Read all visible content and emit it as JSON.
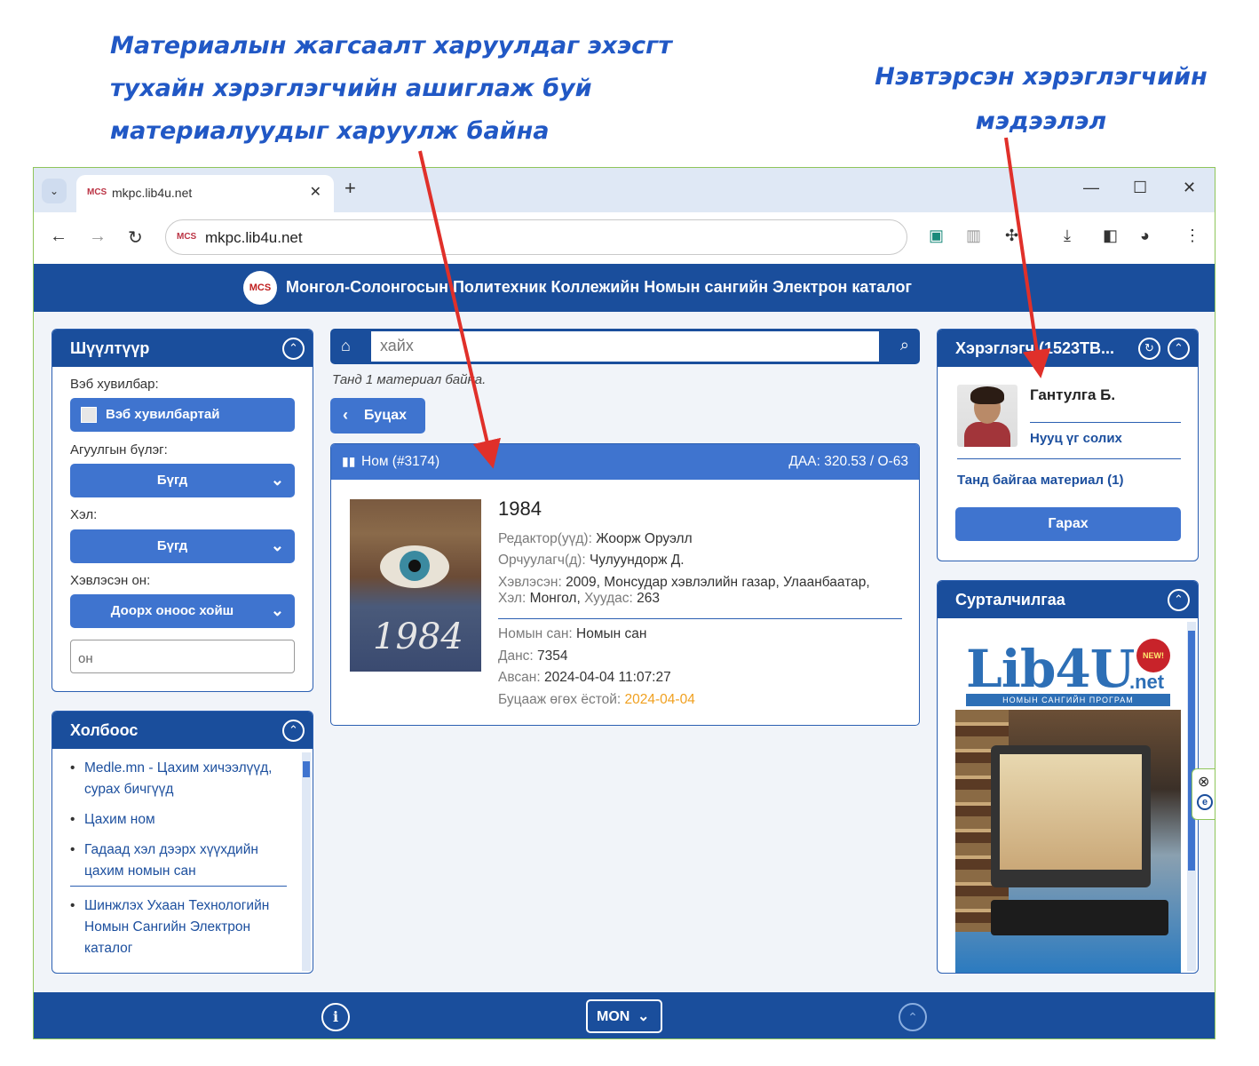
{
  "annotations": {
    "left_line1": "Материалын жагсаалт харуулдаг эхэсгт",
    "left_line2": "тухайн хэрэглэгчийн ашиглаж буй",
    "left_line3": "материалуудыг харуулж байна",
    "right_line1": "Нэвтэрсэн хэрэглэгчийн",
    "right_line2": "мэдээлэл",
    "arrow_color": "#e0302a"
  },
  "browser": {
    "tab_title": "mkpc.lib4u.net",
    "favicon_text": "MCS",
    "new_tab": "+",
    "url": "mkpc.lib4u.net"
  },
  "site": {
    "logo_text": "MCS",
    "title": "Монгол-Солонгосын Политехник Коллежийн Номын сангийн Электрон каталог"
  },
  "filter": {
    "title": "Шүүлтүүр",
    "web_version_label": "Вэб хувилбар:",
    "web_version_option": "Вэб хувилбартай",
    "section_label": "Агуулгын бүлэг:",
    "section_value": "Бүгд",
    "language_label": "Хэл:",
    "language_value": "Бүгд",
    "year_label": "Хэвлэсэн он:",
    "year_value": "Доорх оноос хойш",
    "year_placeholder": "он"
  },
  "links": {
    "title": "Холбоос",
    "items": [
      "Medle.mn - Цахим хичээлүүд, сурах бичгүүд",
      "Цахим ном",
      "Гадаад хэл дээрх хүүхдийн цахим номын сан",
      "Шинжлэх Ухаан Технологийн Номын Сангийн Электрон каталог"
    ]
  },
  "search": {
    "placeholder": "хайх"
  },
  "results": {
    "count_text": "Танд 1 материал байна.",
    "back_label": "Буцах"
  },
  "book": {
    "header_type": "Ном (#3174)",
    "classification": "ДАА: 320.53 / О-63",
    "cover_text": "1984",
    "title": "1984",
    "editor_label": "Редактор(уүд):",
    "editor": "Жоорж Оруэлл",
    "translator_label": "Орчуулагч(д):",
    "translator": "Чулуундорж Д.",
    "published_label": "Хэвлэсэн:",
    "published": "2009, Монсудар хэвлэлийн газар, Улаанбаатар,",
    "language_label": "Хэл:",
    "language": "Монгол,",
    "pages_label": "Хуудас:",
    "pages": "263",
    "library_label": "Номын сан:",
    "library": "Номын сан",
    "account_label": "Данс:",
    "account": "7354",
    "borrowed_label": "Авсан:",
    "borrowed": "2024-04-04 11:07:27",
    "due_label": "Буцааж өгөх ёстой:",
    "due": "2024-04-04",
    "due_color": "#f0a020"
  },
  "user": {
    "title": "Хэрэглэгч (1523ТВ...",
    "name": "Гантулга Б.",
    "change_password": "Нууц үг солих",
    "borrowed_materials": "Танд байгаа материал (1)",
    "logout": "Гарах"
  },
  "ads": {
    "title": "Сурталчилгаа",
    "brand": "Lib4U",
    "net": ".net",
    "badge": "NEW!",
    "tagline": "НОМЫН САНГИЙН ПРОГРАМ"
  },
  "footer": {
    "info_icon": "i",
    "language": "MON"
  },
  "colors": {
    "primary": "#1a4e9c",
    "button": "#3f74cf",
    "link": "#1c4f9e",
    "annotation": "#2158c5"
  }
}
